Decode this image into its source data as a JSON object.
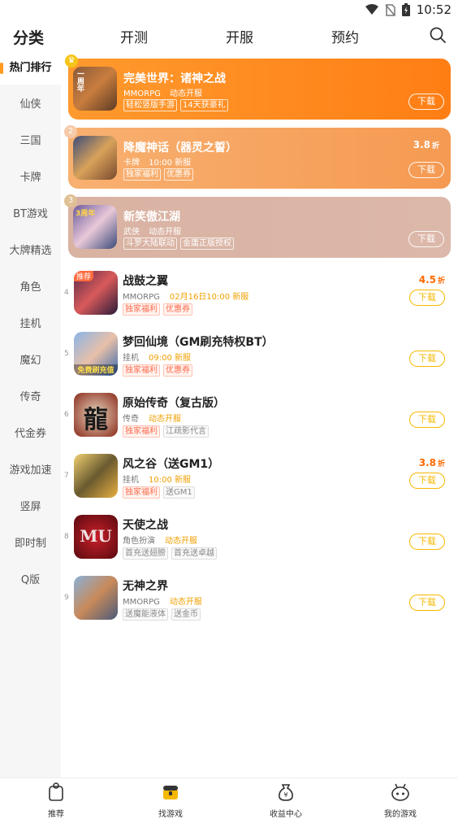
{
  "status": {
    "time": "10:52"
  },
  "topnav": {
    "tabs": [
      {
        "label": "分类",
        "active": true
      },
      {
        "label": "开测"
      },
      {
        "label": "开服"
      },
      {
        "label": "预约"
      }
    ]
  },
  "sidebar": {
    "items": [
      "热门排行",
      "仙侠",
      "三国",
      "卡牌",
      "BT游戏",
      "大牌精选",
      "角色",
      "挂机",
      "魔幻",
      "传奇",
      "代金券",
      "游戏加速",
      "竖屏",
      "即时制",
      "Q版"
    ]
  },
  "featured": [
    {
      "rank": "1",
      "name": "完美世界：诸神之战",
      "category": "MMORPG",
      "server": "动态开服",
      "tags": [
        "轻松竖版手游",
        "14天获豪礼"
      ],
      "discount": "",
      "discount_unit": "",
      "download": "下载",
      "icon_text": "一周年"
    },
    {
      "rank": "2",
      "name": "降魔神话（器灵之誓）",
      "category": "卡牌",
      "server": "10:00 新服",
      "tags": [
        "独家福利",
        "优惠券"
      ],
      "discount": "3.8",
      "discount_unit": "折",
      "download": "下载",
      "icon_text": ""
    },
    {
      "rank": "3",
      "name": "新笑傲江湖",
      "category": "武侠",
      "server": "动态开服",
      "tags": [
        "斗罗大陆联动",
        "金庸正版授权"
      ],
      "discount": "",
      "discount_unit": "",
      "download": "下载",
      "icon_text": "3周年"
    }
  ],
  "list": [
    {
      "rank": "4",
      "name": "战鼓之翼",
      "category": "MMORPG",
      "server": "02月16日10:00 新服",
      "tags": [
        {
          "t": "独家福利",
          "s": "red"
        },
        {
          "t": "优惠券",
          "s": "red"
        }
      ],
      "discount": "4.5",
      "discount_unit": "折",
      "download": "下载",
      "badge": "推荐",
      "icon_text": ""
    },
    {
      "rank": "5",
      "name": "梦回仙境（GM刷充特权BT）",
      "category": "挂机",
      "server": "09:00 新服",
      "tags": [
        {
          "t": "独家福利",
          "s": "red"
        },
        {
          "t": "优惠券",
          "s": "red"
        }
      ],
      "discount": "",
      "discount_unit": "",
      "download": "下载",
      "badge": "",
      "icon_text": "免费刷充值"
    },
    {
      "rank": "6",
      "name": "原始传奇（复古版）",
      "category": "传奇",
      "server": "动态开服",
      "tags": [
        {
          "t": "独家福利",
          "s": "red"
        },
        {
          "t": "江疏影代言",
          "s": "gray"
        }
      ],
      "discount": "",
      "discount_unit": "",
      "download": "下载",
      "badge": "",
      "icon_text": "龍"
    },
    {
      "rank": "7",
      "name": "风之谷（送GM1）",
      "category": "挂机",
      "server": "10:00 新服",
      "tags": [
        {
          "t": "独家福利",
          "s": "red"
        },
        {
          "t": "送GM1",
          "s": "gray"
        }
      ],
      "discount": "3.8",
      "discount_unit": "折",
      "download": "下载",
      "badge": "",
      "icon_text": ""
    },
    {
      "rank": "8",
      "name": "天使之战",
      "category": "角色扮演",
      "server": "动态开服",
      "tags": [
        {
          "t": "首充送翅膀",
          "s": "gray"
        },
        {
          "t": "首充送卓越",
          "s": "gray"
        }
      ],
      "discount": "",
      "discount_unit": "",
      "download": "下载",
      "badge": "",
      "icon_text": "MU"
    },
    {
      "rank": "9",
      "name": "无神之界",
      "category": "MMORPG",
      "server": "动态开服",
      "tags": [
        {
          "t": "送魔能液体",
          "s": "gray"
        },
        {
          "t": "送金币",
          "s": "gray"
        }
      ],
      "discount": "",
      "discount_unit": "",
      "download": "下载",
      "badge": "",
      "icon_text": ""
    }
  ],
  "bottombar": {
    "items": [
      "推荐",
      "找游戏",
      "收益中心",
      "我的游戏"
    ]
  },
  "colors": {
    "accent": "#ff9a1e",
    "card1": "#ff8c1a",
    "card2": "#f7a25a",
    "card3": "#d9b3a3",
    "btn": "#f5b800",
    "discount": "#ff6a00"
  }
}
